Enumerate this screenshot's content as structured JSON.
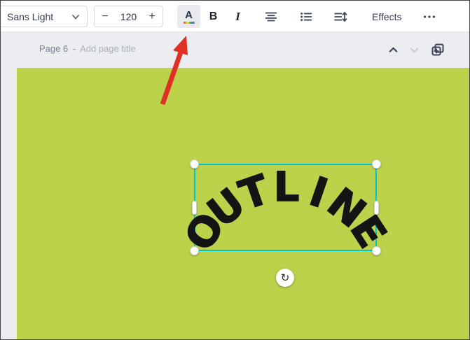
{
  "toolbar": {
    "font_name": "Sans Light",
    "decrease_label": "−",
    "font_size": "120",
    "increase_label": "+",
    "color_label": "A",
    "bold_label": "B",
    "italic_label": "I",
    "effects_label": "Effects"
  },
  "page_header": {
    "page_label": "Page 6",
    "separator": "-",
    "title_placeholder": "Add page title"
  },
  "canvas": {
    "curved_text": "OUTLINE",
    "rotate_icon": "↻"
  },
  "colors": {
    "page_green": "#bdd24b",
    "selection_teal": "#00c4cc",
    "arrow_red": "#e03024",
    "toolbar_icon": "#3d4757"
  }
}
